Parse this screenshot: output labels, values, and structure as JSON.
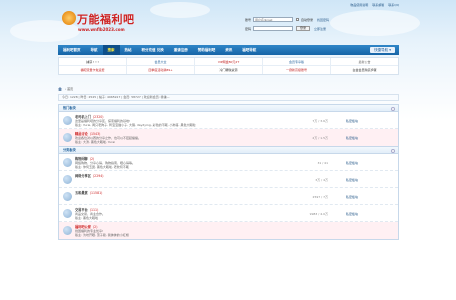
{
  "site": {
    "name": "万能福利吧",
    "url": "www.wnflb2023.com"
  },
  "top_links": [
    "物品使用说明",
    "联系邮箱",
    "联系QQ"
  ],
  "login": {
    "user_label": "账号",
    "user_placeholder": "用户名/Email",
    "pass_label": "密码",
    "pass_placeholder": "",
    "auto_login": "自动登录",
    "find_pwd": "找回密码",
    "login_btn": "登录",
    "register": "立即注册"
  },
  "nav": {
    "items": [
      "福利吧首页",
      "导航",
      "搜索",
      "热帖",
      "积分充值 兑换",
      "邀请注册",
      "赞助福利吧",
      "资讯",
      "福吧导航"
    ],
    "active_index": 2,
    "quick": "快捷导航 ▾"
  },
  "ads": [
    [
      "捕获 ! ! !",
      "会员大全",
      "VIP网盘80元2T",
      "会员专享版",
      "最新公告"
    ],
    [
      "福吧流量卡免运费",
      "四季度活动满89+",
      "冷门稀缺资源",
      "一键新高级账号",
      "白金会员购买步骤"
    ]
  ],
  "ad_colors": [
    "#333333",
    "#1b5c98",
    "#c22222",
    "#1b5c98",
    "#666666",
    "#c22222",
    "#c22222",
    "#333333",
    "#c22222",
    "#333333"
  ],
  "breadcrumb": "›  首页",
  "stats": "今日: 1228  |  昨日: 2545  |  帖子: 4965917  |  会员: 58727  |  欢迎新会员: 徐谦—",
  "sections": [
    {
      "title": "热门板块",
      "forums": [
        {
          "name": "老司机上门",
          "count": "(2320)",
          "desc": "这里是福利吧的分享区，探索福利的基地!",
          "mod": "版主: Yurai, 两只老狗子, 鸭宝宝猫小子, 大猪, daydying, 彩色的不眠, 小狗哥, 黑色大眠啦",
          "stats": "7万 / 3.6万",
          "last": "私密板块",
          "pink": false
        },
        {
          "name": "精品讨论",
          "count": "(1543)",
          "desc": "欢迎各位对以赛的分享之作，也可以不钮起播播。",
          "mod": "版主: 大渣, 黑色大眠啦, Yurai",
          "stats": "2万 / 1.5万",
          "last": "私密板块",
          "pink": true
        }
      ]
    },
    {
      "title": "分类板块",
      "forums": [
        {
          "name": "购物闲聊",
          "count": "(2)",
          "desc": "网络购物，分享心得，购物指南，晒心得等。",
          "mod": "版主: 你何玉翼, 黑色大眠啦, 老牧何不眠",
          "stats": "31 / 41",
          "last": "私密板块",
          "pink": false
        },
        {
          "name": "网络分享区",
          "count": "(2294)",
          "desc": "",
          "mod": "",
          "stats": "3万 / 4万",
          "last": "私密板块",
          "pink": false
        },
        {
          "name": "五和悬赏",
          "count": "(11581)",
          "desc": "",
          "mod": "",
          "stats": "2597 / 7万",
          "last": "私密板块",
          "pink": false
        },
        {
          "name": "交易平台",
          "count": "(111)",
          "desc": "商品交易，商业合作。",
          "mod": "版主: 黑色大眠啦",
          "stats": "9983 / 4.0万",
          "last": "私密板块",
          "pink": false
        },
        {
          "name": "福利吧公家",
          "count": "(2)",
          "desc": "线国福利的专业优享!",
          "mod": "版主: 为坊开眼, 萧子筱, 我抹抹的小红帽",
          "stats": "",
          "last": "",
          "pink": true
        }
      ]
    }
  ]
}
